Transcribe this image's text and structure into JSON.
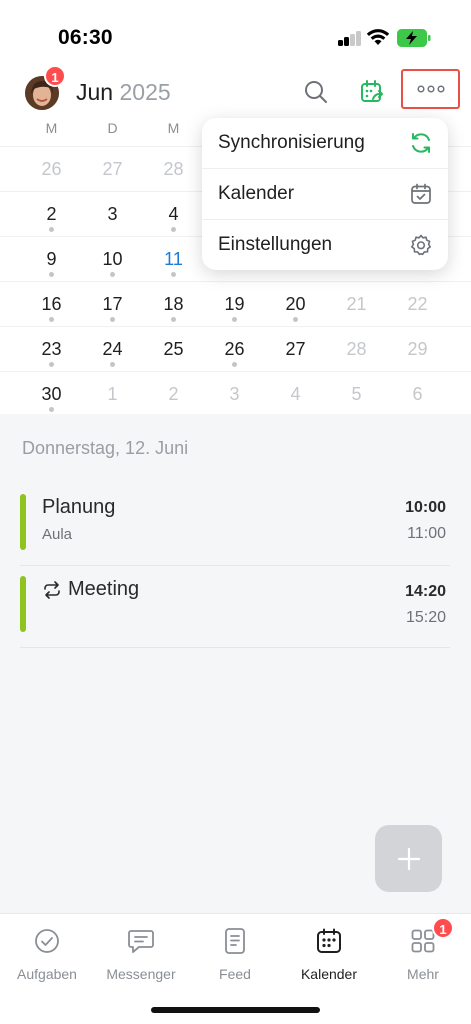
{
  "status_bar": {
    "time": "06:30"
  },
  "header": {
    "month": "Jun",
    "year": "2025",
    "avatar_badge": "1"
  },
  "calendar": {
    "weekdays": [
      "M",
      "D",
      "M"
    ],
    "today": "11",
    "rows": [
      [
        {
          "n": "26",
          "muted": true
        },
        {
          "n": "27",
          "muted": true
        },
        {
          "n": "28",
          "muted": true
        }
      ],
      [
        {
          "n": "2",
          "dot": true
        },
        {
          "n": "3"
        },
        {
          "n": "4",
          "dot": true
        }
      ],
      [
        {
          "n": "9",
          "dot": true
        },
        {
          "n": "10",
          "dot": true
        },
        {
          "n": "11",
          "dot": true,
          "today": true
        }
      ],
      [
        {
          "n": "16",
          "dot": true
        },
        {
          "n": "17",
          "dot": true
        },
        {
          "n": "18",
          "dot": true
        },
        {
          "n": "19",
          "dot": true
        },
        {
          "n": "20",
          "dot": true
        },
        {
          "n": "21",
          "muted": true
        },
        {
          "n": "22",
          "muted": true
        }
      ],
      [
        {
          "n": "23",
          "dot": true
        },
        {
          "n": "24",
          "dot": true
        },
        {
          "n": "25"
        },
        {
          "n": "26",
          "dot": true
        },
        {
          "n": "27"
        },
        {
          "n": "28",
          "muted": true
        },
        {
          "n": "29",
          "muted": true
        }
      ],
      [
        {
          "n": "30",
          "dot": true
        },
        {
          "n": "1",
          "muted": true
        },
        {
          "n": "2",
          "muted": true
        },
        {
          "n": "3",
          "muted": true
        },
        {
          "n": "4",
          "muted": true
        },
        {
          "n": "5",
          "muted": true
        },
        {
          "n": "6",
          "muted": true
        }
      ]
    ]
  },
  "dropdown_menu": {
    "items": [
      {
        "label": "Synchronisierung",
        "icon": "sync-icon"
      },
      {
        "label": "Kalender",
        "icon": "calendar-check-icon"
      },
      {
        "label": "Einstellungen",
        "icon": "gear-icon"
      }
    ]
  },
  "agenda": {
    "date_heading": "Donnerstag, 12. Juni",
    "events": [
      {
        "title": "Planung",
        "location": "Aula",
        "start": "10:00",
        "end": "11:00",
        "recurring": false
      },
      {
        "title": "Meeting",
        "location": "",
        "start": "14:20",
        "end": "15:20",
        "recurring": true
      }
    ]
  },
  "tabbar": {
    "tabs": [
      {
        "label": "Aufgaben",
        "icon": "check-circle-icon"
      },
      {
        "label": "Messenger",
        "icon": "chat-icon"
      },
      {
        "label": "Feed",
        "icon": "feed-icon"
      },
      {
        "label": "Kalender",
        "icon": "calendar-icon",
        "active": true
      },
      {
        "label": "Mehr",
        "icon": "grid-icon",
        "badge": "1"
      }
    ]
  },
  "colors": {
    "accent_green": "#27b861",
    "event_bar": "#8fc31f",
    "today_blue": "#1a7cd8",
    "badge_red": "#ff4d4f",
    "highlight_red": "#e8514a"
  }
}
